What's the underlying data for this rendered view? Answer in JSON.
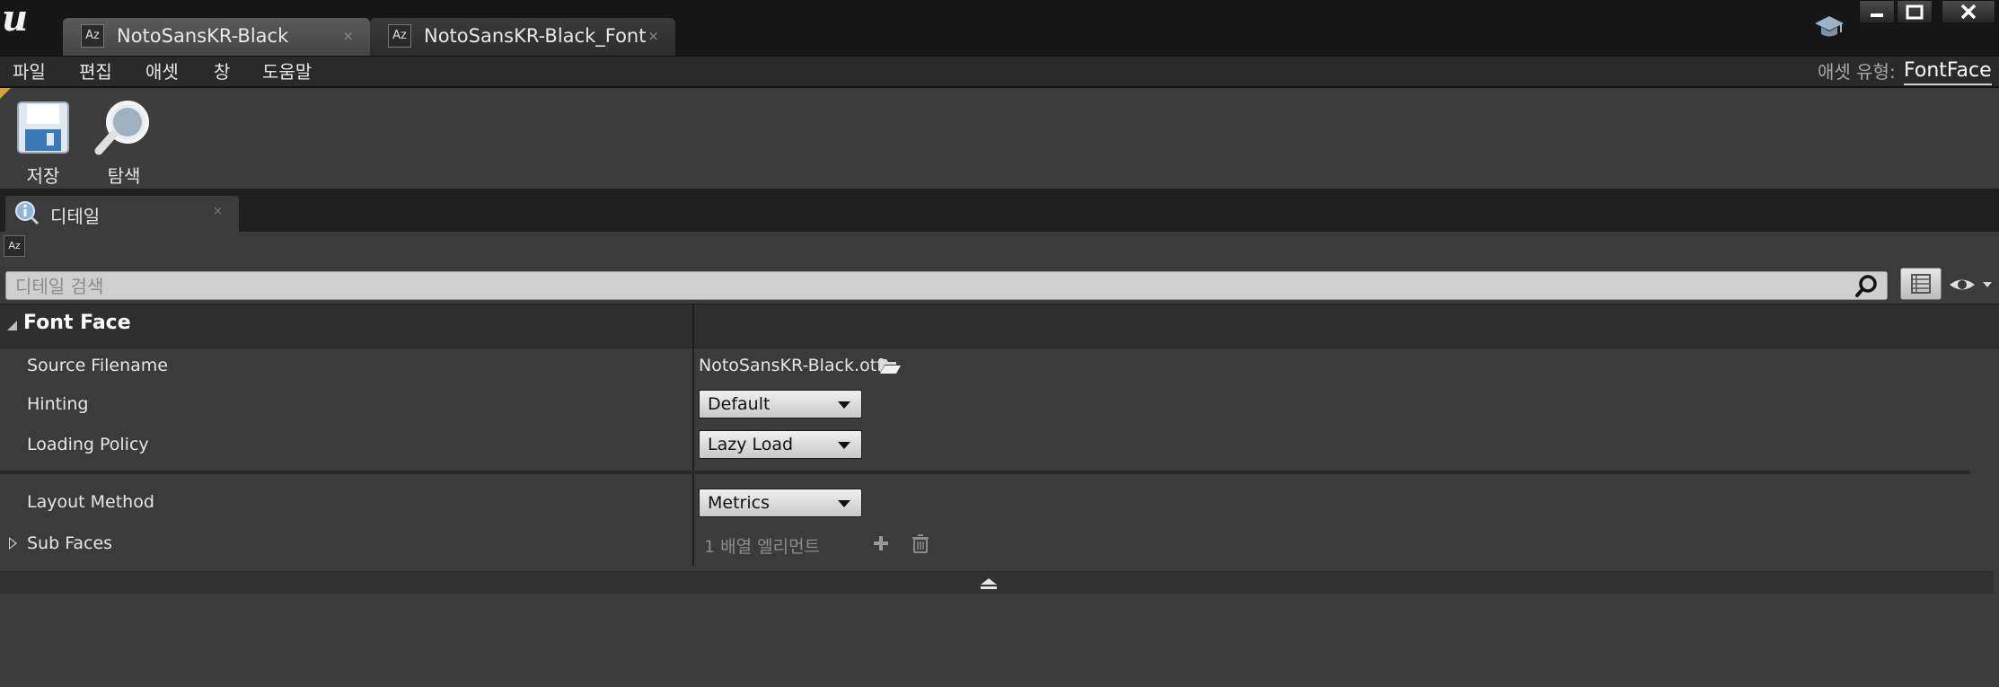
{
  "window": {
    "tabs": [
      {
        "label": "NotoSansKR-Black",
        "icon": "font-asset-icon",
        "close": "×",
        "active": true
      },
      {
        "label": "NotoSansKR-Black_Font",
        "icon": "font-asset-icon",
        "close": "×",
        "active": false
      }
    ]
  },
  "menu": {
    "items": [
      "파일",
      "편집",
      "애셋",
      "창",
      "도움말"
    ],
    "asset_type_label": "애셋 유형:",
    "asset_type_value": "FontFace"
  },
  "toolbar": {
    "save_label": "저장",
    "browse_label": "탐색"
  },
  "details_panel": {
    "tab_label": "디테일",
    "tab_close": "×",
    "search_placeholder": "디테일 검색",
    "category": "Font Face",
    "properties": {
      "source_filename": {
        "label": "Source Filename",
        "value": "NotoSansKR-Black.otf"
      },
      "hinting": {
        "label": "Hinting",
        "value": "Default"
      },
      "loading_policy": {
        "label": "Loading Policy",
        "value": "Lazy Load"
      },
      "layout_method": {
        "label": "Layout Method",
        "value": "Metrics"
      },
      "sub_faces": {
        "label": "Sub Faces",
        "value": "1 배열 엘리먼트"
      }
    }
  },
  "colors": {
    "titlebar": "#161616",
    "menubar": "#2a2a2a",
    "panel": "#3b3b3b",
    "accent_corner": "#d6a23a"
  }
}
